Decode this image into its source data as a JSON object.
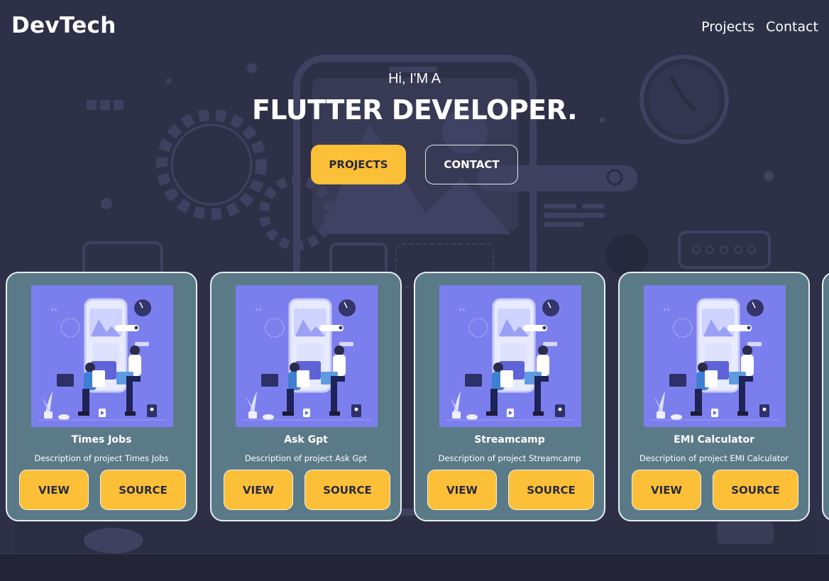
{
  "header": {
    "logo": "DevTech",
    "nav": [
      "Projects",
      "Contact"
    ]
  },
  "hero": {
    "intro": "Hi, I'M A",
    "title": "FLUTTER DEVELOPER.",
    "buttons": {
      "primary": "PROJECTS",
      "secondary": "CONTACT"
    }
  },
  "projects": [
    {
      "title": "Times Jobs",
      "description": "Description of project Times Jobs",
      "view_label": "VIEW",
      "source_label": "SOURCE"
    },
    {
      "title": "Ask Gpt",
      "description": "Description of project Ask Gpt",
      "view_label": "VIEW",
      "source_label": "SOURCE"
    },
    {
      "title": "Streamcamp",
      "description": "Description of project Streamcamp",
      "view_label": "VIEW",
      "source_label": "SOURCE"
    },
    {
      "title": "EMI Calculator",
      "description": "Description of project EMI Calculator",
      "view_label": "VIEW",
      "source_label": "SOURCE"
    }
  ],
  "colors": {
    "background": "#2e3047",
    "accent": "#fbbf38",
    "card": "#5b7a87",
    "thumbnail": "#7b7fed"
  }
}
